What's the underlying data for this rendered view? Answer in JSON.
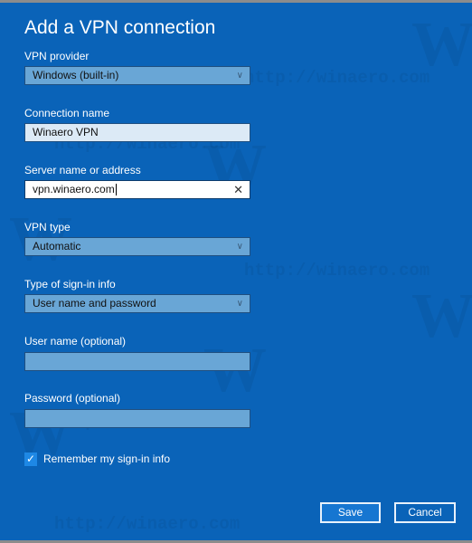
{
  "dialog": {
    "title": "Add a VPN connection",
    "vpn_provider": {
      "label": "VPN provider",
      "value": "Windows (built-in)"
    },
    "connection_name": {
      "label": "Connection name",
      "value": "Winaero VPN"
    },
    "server": {
      "label": "Server name or address",
      "value": "vpn.winaero.com"
    },
    "vpn_type": {
      "label": "VPN type",
      "value": "Automatic"
    },
    "signin_type": {
      "label": "Type of sign-in info",
      "value": "User name and password"
    },
    "username": {
      "label": "User name (optional)",
      "value": ""
    },
    "password": {
      "label": "Password (optional)",
      "value": ""
    },
    "remember": {
      "label": "Remember my sign-in info",
      "checked": true
    },
    "buttons": {
      "save": "Save",
      "cancel": "Cancel"
    }
  },
  "icons": {
    "chevron": "∨",
    "clear": "✕",
    "check": "✓"
  },
  "watermark": {
    "logo": "W",
    "text": "http://winaero.com"
  }
}
